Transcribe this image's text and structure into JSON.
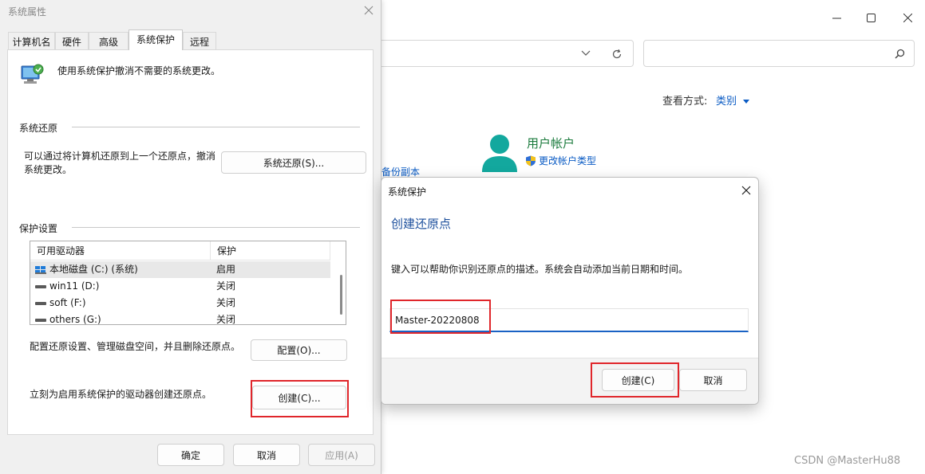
{
  "control_panel": {
    "view_by_label": "查看方式:",
    "view_by_value": "类别",
    "user_accounts_title": "用户帐户",
    "change_account_type": "更改帐户类型",
    "backup_link": "备份副本"
  },
  "system_properties": {
    "title": "系统属性",
    "tabs": [
      "计算机名",
      "硬件",
      "高级",
      "系统保护",
      "远程"
    ],
    "active_tab": "系统保护",
    "intro": "使用系统保护撤消不需要的系统更改。",
    "restore_section": "系统还原",
    "restore_desc": "可以通过将计算机还原到上一个还原点，撤消系统更改。",
    "restore_button": "系统还原(S)...",
    "protection_section": "保护设置",
    "drive_columns": [
      "可用驱动器",
      "保护"
    ],
    "drives": [
      {
        "name": "本地磁盘 (C:) (系统)",
        "protection": "启用"
      },
      {
        "name": "win11 (D:)",
        "protection": "关闭"
      },
      {
        "name": "soft (F:)",
        "protection": "关闭"
      },
      {
        "name": "others (G:)",
        "protection": "关闭"
      }
    ],
    "config_desc": "配置还原设置、管理磁盘空间，并且删除还原点。",
    "config_button": "配置(O)...",
    "create_desc": "立刻为启用系统保护的驱动器创建还原点。",
    "create_button": "创建(C)...",
    "ok_button": "确定",
    "cancel_button": "取消",
    "apply_button": "应用(A)"
  },
  "system_protection_dialog": {
    "title": "系统保护",
    "heading": "创建还原点",
    "desc": "键入可以帮助你识别还原点的描述。系统会自动添加当前日期和时间。",
    "input_value": "Master-20220808",
    "create_button": "创建(C)",
    "cancel_button": "取消"
  },
  "watermark": "CSDN @MasterHu88",
  "colors": {
    "highlight_box": "#e0262b",
    "accent_blue": "#1a62c4",
    "link_blue": "#0a5bc4",
    "user_green": "#1a7a3c",
    "avatar_teal": "#13a89e"
  }
}
